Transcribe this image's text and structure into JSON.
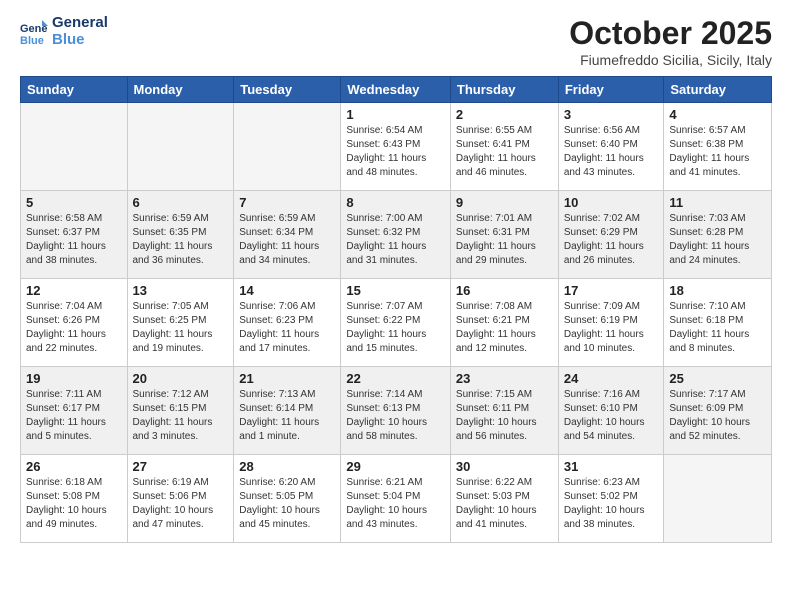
{
  "header": {
    "logo_line1": "General",
    "logo_line2": "Blue",
    "month": "October 2025",
    "location": "Fiumefreddo Sicilia, Sicily, Italy"
  },
  "weekdays": [
    "Sunday",
    "Monday",
    "Tuesday",
    "Wednesday",
    "Thursday",
    "Friday",
    "Saturday"
  ],
  "weeks": [
    [
      {
        "day": "",
        "info": ""
      },
      {
        "day": "",
        "info": ""
      },
      {
        "day": "",
        "info": ""
      },
      {
        "day": "1",
        "info": "Sunrise: 6:54 AM\nSunset: 6:43 PM\nDaylight: 11 hours\nand 48 minutes."
      },
      {
        "day": "2",
        "info": "Sunrise: 6:55 AM\nSunset: 6:41 PM\nDaylight: 11 hours\nand 46 minutes."
      },
      {
        "day": "3",
        "info": "Sunrise: 6:56 AM\nSunset: 6:40 PM\nDaylight: 11 hours\nand 43 minutes."
      },
      {
        "day": "4",
        "info": "Sunrise: 6:57 AM\nSunset: 6:38 PM\nDaylight: 11 hours\nand 41 minutes."
      }
    ],
    [
      {
        "day": "5",
        "info": "Sunrise: 6:58 AM\nSunset: 6:37 PM\nDaylight: 11 hours\nand 38 minutes."
      },
      {
        "day": "6",
        "info": "Sunrise: 6:59 AM\nSunset: 6:35 PM\nDaylight: 11 hours\nand 36 minutes."
      },
      {
        "day": "7",
        "info": "Sunrise: 6:59 AM\nSunset: 6:34 PM\nDaylight: 11 hours\nand 34 minutes."
      },
      {
        "day": "8",
        "info": "Sunrise: 7:00 AM\nSunset: 6:32 PM\nDaylight: 11 hours\nand 31 minutes."
      },
      {
        "day": "9",
        "info": "Sunrise: 7:01 AM\nSunset: 6:31 PM\nDaylight: 11 hours\nand 29 minutes."
      },
      {
        "day": "10",
        "info": "Sunrise: 7:02 AM\nSunset: 6:29 PM\nDaylight: 11 hours\nand 26 minutes."
      },
      {
        "day": "11",
        "info": "Sunrise: 7:03 AM\nSunset: 6:28 PM\nDaylight: 11 hours\nand 24 minutes."
      }
    ],
    [
      {
        "day": "12",
        "info": "Sunrise: 7:04 AM\nSunset: 6:26 PM\nDaylight: 11 hours\nand 22 minutes."
      },
      {
        "day": "13",
        "info": "Sunrise: 7:05 AM\nSunset: 6:25 PM\nDaylight: 11 hours\nand 19 minutes."
      },
      {
        "day": "14",
        "info": "Sunrise: 7:06 AM\nSunset: 6:23 PM\nDaylight: 11 hours\nand 17 minutes."
      },
      {
        "day": "15",
        "info": "Sunrise: 7:07 AM\nSunset: 6:22 PM\nDaylight: 11 hours\nand 15 minutes."
      },
      {
        "day": "16",
        "info": "Sunrise: 7:08 AM\nSunset: 6:21 PM\nDaylight: 11 hours\nand 12 minutes."
      },
      {
        "day": "17",
        "info": "Sunrise: 7:09 AM\nSunset: 6:19 PM\nDaylight: 11 hours\nand 10 minutes."
      },
      {
        "day": "18",
        "info": "Sunrise: 7:10 AM\nSunset: 6:18 PM\nDaylight: 11 hours\nand 8 minutes."
      }
    ],
    [
      {
        "day": "19",
        "info": "Sunrise: 7:11 AM\nSunset: 6:17 PM\nDaylight: 11 hours\nand 5 minutes."
      },
      {
        "day": "20",
        "info": "Sunrise: 7:12 AM\nSunset: 6:15 PM\nDaylight: 11 hours\nand 3 minutes."
      },
      {
        "day": "21",
        "info": "Sunrise: 7:13 AM\nSunset: 6:14 PM\nDaylight: 11 hours\nand 1 minute."
      },
      {
        "day": "22",
        "info": "Sunrise: 7:14 AM\nSunset: 6:13 PM\nDaylight: 10 hours\nand 58 minutes."
      },
      {
        "day": "23",
        "info": "Sunrise: 7:15 AM\nSunset: 6:11 PM\nDaylight: 10 hours\nand 56 minutes."
      },
      {
        "day": "24",
        "info": "Sunrise: 7:16 AM\nSunset: 6:10 PM\nDaylight: 10 hours\nand 54 minutes."
      },
      {
        "day": "25",
        "info": "Sunrise: 7:17 AM\nSunset: 6:09 PM\nDaylight: 10 hours\nand 52 minutes."
      }
    ],
    [
      {
        "day": "26",
        "info": "Sunrise: 6:18 AM\nSunset: 5:08 PM\nDaylight: 10 hours\nand 49 minutes."
      },
      {
        "day": "27",
        "info": "Sunrise: 6:19 AM\nSunset: 5:06 PM\nDaylight: 10 hours\nand 47 minutes."
      },
      {
        "day": "28",
        "info": "Sunrise: 6:20 AM\nSunset: 5:05 PM\nDaylight: 10 hours\nand 45 minutes."
      },
      {
        "day": "29",
        "info": "Sunrise: 6:21 AM\nSunset: 5:04 PM\nDaylight: 10 hours\nand 43 minutes."
      },
      {
        "day": "30",
        "info": "Sunrise: 6:22 AM\nSunset: 5:03 PM\nDaylight: 10 hours\nand 41 minutes."
      },
      {
        "day": "31",
        "info": "Sunrise: 6:23 AM\nSunset: 5:02 PM\nDaylight: 10 hours\nand 38 minutes."
      },
      {
        "day": "",
        "info": ""
      }
    ]
  ]
}
